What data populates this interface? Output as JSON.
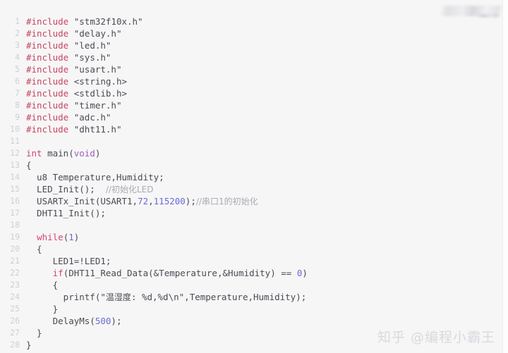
{
  "editor": {
    "language": "c",
    "background_color": "#f6f6f7",
    "gutter_color": "#cfcfd4",
    "default_text_color": "#4a4a52",
    "token_colors": {
      "preprocessor": "#c7455f",
      "keyword": "#d6456b",
      "type": "#9b5fc0",
      "number": "#6b6bd6",
      "string": "#4a4a52",
      "comment": "#aaaab2"
    },
    "lines": [
      {
        "no": "1",
        "tokens": [
          {
            "t": "#include",
            "c": "pre"
          },
          {
            "t": " ",
            "c": "plain"
          },
          {
            "t": "\"stm32f10x.h\"",
            "c": "str"
          }
        ]
      },
      {
        "no": "2",
        "tokens": [
          {
            "t": "#include",
            "c": "pre"
          },
          {
            "t": " ",
            "c": "plain"
          },
          {
            "t": "\"delay.h\"",
            "c": "str"
          }
        ]
      },
      {
        "no": "3",
        "tokens": [
          {
            "t": "#include",
            "c": "pre"
          },
          {
            "t": " ",
            "c": "plain"
          },
          {
            "t": "\"led.h\"",
            "c": "str"
          }
        ]
      },
      {
        "no": "4",
        "tokens": [
          {
            "t": "#include",
            "c": "pre"
          },
          {
            "t": " ",
            "c": "plain"
          },
          {
            "t": "\"sys.h\"",
            "c": "str"
          }
        ]
      },
      {
        "no": "5",
        "tokens": [
          {
            "t": "#include",
            "c": "pre"
          },
          {
            "t": " ",
            "c": "plain"
          },
          {
            "t": "\"usart.h\"",
            "c": "str"
          }
        ]
      },
      {
        "no": "6",
        "tokens": [
          {
            "t": "#include",
            "c": "pre"
          },
          {
            "t": " ",
            "c": "plain"
          },
          {
            "t": "<string.h>",
            "c": "str"
          }
        ]
      },
      {
        "no": "7",
        "tokens": [
          {
            "t": "#include",
            "c": "pre"
          },
          {
            "t": " ",
            "c": "plain"
          },
          {
            "t": "<stdlib.h>",
            "c": "str"
          }
        ]
      },
      {
        "no": "8",
        "tokens": [
          {
            "t": "#include",
            "c": "pre"
          },
          {
            "t": " ",
            "c": "plain"
          },
          {
            "t": "\"timer.h\"",
            "c": "str"
          }
        ]
      },
      {
        "no": "9",
        "tokens": [
          {
            "t": "#include",
            "c": "pre"
          },
          {
            "t": " ",
            "c": "plain"
          },
          {
            "t": "\"adc.h\"",
            "c": "str"
          }
        ]
      },
      {
        "no": "10",
        "tokens": [
          {
            "t": "#include",
            "c": "pre"
          },
          {
            "t": " ",
            "c": "plain"
          },
          {
            "t": "\"dht11.h\"",
            "c": "str"
          }
        ]
      },
      {
        "no": "11",
        "tokens": []
      },
      {
        "no": "12",
        "tokens": [
          {
            "t": "int",
            "c": "kw"
          },
          {
            "t": " main(",
            "c": "plain"
          },
          {
            "t": "void",
            "c": "type"
          },
          {
            "t": ")",
            "c": "plain"
          }
        ]
      },
      {
        "no": "13",
        "tokens": [
          {
            "t": "{",
            "c": "plain"
          }
        ]
      },
      {
        "no": "14",
        "tokens": [
          {
            "t": "  u8 Temperature,Humidity;",
            "c": "plain"
          }
        ]
      },
      {
        "no": "15",
        "tokens": [
          {
            "t": "  LED_Init();  ",
            "c": "plain"
          },
          {
            "t": "//初始化LED",
            "c": "cmt",
            "cjk": true
          }
        ]
      },
      {
        "no": "16",
        "tokens": [
          {
            "t": "  USARTx_Init(USART1,",
            "c": "plain"
          },
          {
            "t": "72",
            "c": "num"
          },
          {
            "t": ",",
            "c": "plain"
          },
          {
            "t": "115200",
            "c": "num"
          },
          {
            "t": ");",
            "c": "plain"
          },
          {
            "t": "//串口1的初始化",
            "c": "cmt",
            "cjk": true
          }
        ]
      },
      {
        "no": "17",
        "tokens": [
          {
            "t": "  DHT11_Init();",
            "c": "plain"
          }
        ]
      },
      {
        "no": "18",
        "tokens": []
      },
      {
        "no": "19",
        "tokens": [
          {
            "t": "  ",
            "c": "plain"
          },
          {
            "t": "while",
            "c": "kw"
          },
          {
            "t": "(",
            "c": "plain"
          },
          {
            "t": "1",
            "c": "num"
          },
          {
            "t": ")",
            "c": "plain"
          }
        ]
      },
      {
        "no": "20",
        "tokens": [
          {
            "t": "  {",
            "c": "plain"
          }
        ]
      },
      {
        "no": "21",
        "tokens": [
          {
            "t": "     LED1=!LED1;",
            "c": "plain"
          }
        ]
      },
      {
        "no": "22",
        "tokens": [
          {
            "t": "     ",
            "c": "plain"
          },
          {
            "t": "if",
            "c": "kw"
          },
          {
            "t": "(DHT11_Read_Data(&Temperature,&Humidity) == ",
            "c": "plain"
          },
          {
            "t": "0",
            "c": "num"
          },
          {
            "t": ")",
            "c": "plain"
          }
        ]
      },
      {
        "no": "23",
        "tokens": [
          {
            "t": "     {",
            "c": "plain"
          }
        ]
      },
      {
        "no": "24",
        "tokens": [
          {
            "t": "       printf(\"",
            "c": "plain"
          },
          {
            "t": "温湿度",
            "c": "plain",
            "cjk": true
          },
          {
            "t": ": %d,%d\\n\",Temperature,Humidity);",
            "c": "plain"
          }
        ]
      },
      {
        "no": "25",
        "tokens": [
          {
            "t": "     }",
            "c": "plain"
          }
        ]
      },
      {
        "no": "26",
        "tokens": [
          {
            "t": "     DelayMs(",
            "c": "plain"
          },
          {
            "t": "500",
            "c": "num"
          },
          {
            "t": ");",
            "c": "plain"
          }
        ]
      },
      {
        "no": "27",
        "tokens": [
          {
            "t": "  }",
            "c": "plain"
          }
        ]
      },
      {
        "no": "28",
        "tokens": [
          {
            "t": "}",
            "c": "plain"
          }
        ]
      }
    ]
  },
  "watermarks": {
    "top_right": {
      "label": "blurred-logo-watermark",
      "text": ""
    },
    "bottom_right": {
      "brand": "知乎",
      "handle": "@编程小霸王",
      "color": "#d9d9de"
    }
  }
}
